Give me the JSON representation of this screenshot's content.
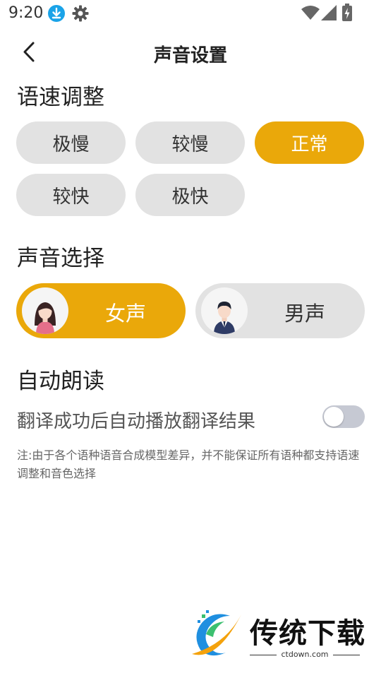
{
  "status_bar": {
    "time": "9:20"
  },
  "header": {
    "title": "声音设置"
  },
  "speed": {
    "title": "语速调整",
    "options": [
      "极慢",
      "较慢",
      "正常",
      "较快",
      "极快"
    ],
    "selected": "正常"
  },
  "voice": {
    "title": "声音选择",
    "options": [
      "女声",
      "男声"
    ],
    "selected": "女声"
  },
  "autoread": {
    "title": "自动朗读",
    "label": "翻译成功后自动播放翻译结果",
    "enabled": false
  },
  "note": "注:由于各个语种语音合成模型差异，并不能保证所有语种都支持语速调整和音色选择",
  "watermark": {
    "text": "传统下载",
    "url": "ctdown.com"
  },
  "colors": {
    "accent": "#eaa80a",
    "pill_bg": "#e2e2e2",
    "toggle_off": "#c6c9d3"
  },
  "icons": {
    "back": "chevron-left-icon",
    "download": "download-icon",
    "settings": "gear-icon",
    "wifi": "wifi-icon",
    "signal": "signal-icon",
    "battery": "battery-icon",
    "female": "female-avatar-icon",
    "male": "male-avatar-icon"
  }
}
